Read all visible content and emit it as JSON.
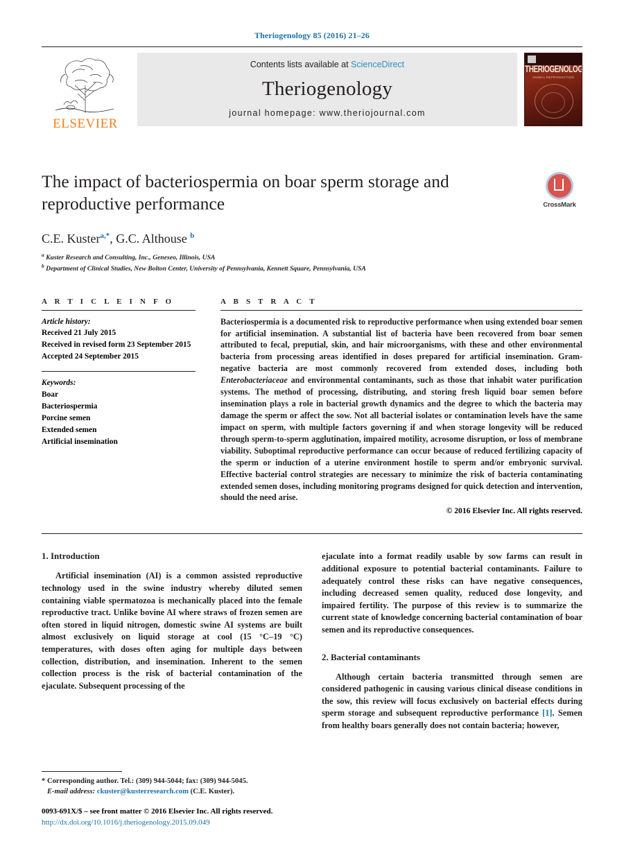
{
  "running_head": "Theriogenology 85 (2016) 21–26",
  "masthead": {
    "contents_prefix": "Contents lists available at ",
    "sciencedirect": "ScienceDirect",
    "journal_name": "Theriogenology",
    "homepage": "journal homepage: www.theriojournal.com",
    "publisher_logo_text": "ELSEVIER",
    "cover_title": "THERIOGENOLOGY",
    "cover_subtitle": "ANIMAL REPRODUCTION"
  },
  "article": {
    "title": "The impact of bacteriospermia on boar sperm storage and reproductive performance",
    "crossmark_label": "CrossMark",
    "authors": [
      {
        "name": "C.E. Kuster",
        "marks": "a,*"
      },
      {
        "name": "G.C. Althouse",
        "marks": "b"
      }
    ],
    "authors_plain": "C.E. Kuster",
    "author2_plain": "G.C. Althouse",
    "affiliations": [
      {
        "mark": "a",
        "text": "Kuster Research and Consulting, Inc., Geneseo, Illinois, USA"
      },
      {
        "mark": "b",
        "text": "Department of Clinical Studies, New Bolton Center, University of Pennsylvania, Kennett Square, Pennsylvania, USA"
      }
    ]
  },
  "article_info": {
    "heading": "A R T I C L E  I N F O",
    "history_label": "Article history:",
    "history": [
      "Received 21 July 2015",
      "Received in revised form 23 September 2015",
      "Accepted 24 September 2015"
    ],
    "keywords_label": "Keywords:",
    "keywords": [
      "Boar",
      "Bacteriospermia",
      "Porcine semen",
      "Extended semen",
      "Artificial insemination"
    ]
  },
  "abstract": {
    "heading": "A B S T R A C T",
    "part1": "Bacteriospermia is a documented risk to reproductive performance when using extended boar semen for artificial insemination. A substantial list of bacteria have been recovered from boar semen attributed to fecal, preputial, skin, and hair microorganisms, with these and other environmental bacteria from processing areas identified in doses prepared for artificial insemination. Gram-negative bacteria are most commonly recovered from extended doses, including both ",
    "italic1": "Enterobacteriaceae",
    "part2": " and environmental contaminants, such as those that inhabit water purification systems. The method of processing, distributing, and storing fresh liquid boar semen before insemination plays a role in bacterial growth dynamics and the degree to which the bacteria may damage the sperm or affect the sow. Not all bacterial isolates or contamination levels have the same impact on sperm, with multiple factors governing if and when storage longevity will be reduced through sperm-to-sperm agglutination, impaired motility, acrosome disruption, or loss of membrane viability. Suboptimal reproductive performance can occur because of reduced fertilizing capacity of the sperm or induction of a uterine environment hostile to sperm and/or embryonic survival. Effective bacterial control strategies are necessary to minimize the risk of bacteria contaminating extended semen doses, including monitoring programs designed for quick detection and intervention, should the need arise.",
    "copyright": "© 2016 Elsevier Inc. All rights reserved."
  },
  "body": {
    "section1_heading": "1. Introduction",
    "section1_para1": "Artificial insemination (AI) is a common assisted reproductive technology used in the swine industry whereby diluted semen containing viable spermatozoa is mechanically placed into the female reproductive tract. Unlike bovine AI where straws of frozen semen are often stored in liquid nitrogen, domestic swine AI systems are built almost exclusively on liquid storage at cool (15 °C–19 °C) temperatures, with doses often aging for multiple days between collection, distribution, and insemination. Inherent to the semen collection process is the risk of bacterial contamination of the ejaculate. Subsequent processing of the",
    "section1_para1_cont": "ejaculate into a format readily usable by sow farms can result in additional exposure to potential bacterial contaminants. Failure to adequately control these risks can have negative consequences, including decreased semen quality, reduced dose longevity, and impaired fertility. The purpose of this review is to summarize the current state of knowledge concerning bacterial contamination of boar semen and its reproductive consequences.",
    "section2_heading": "2. Bacterial contaminants",
    "section2_para1_a": "Although certain bacteria transmitted through semen are considered pathogenic in causing various clinical disease conditions in the sow, this review will focus exclusively on bacterial effects during sperm storage and subsequent reproductive performance ",
    "section2_ref": "[1]",
    "section2_para1_b": ". Semen from healthy boars generally does not contain bacteria; however,"
  },
  "footnotes": {
    "corresponding": "* Corresponding author. Tel.: (309) 944-5044; fax: (309) 944-5045.",
    "email_label": "E-mail address:",
    "email": "ckuster@kusterresearch.com",
    "email_owner": "(C.E. Kuster).",
    "issn": "0093-691X/$ – see front matter © 2016 Elsevier Inc. All rights reserved.",
    "doi": "http://dx.doi.org/10.1016/j.theriogenology.2015.09.049"
  },
  "colors": {
    "link_blue": "#1b72a8",
    "sciencedirect_blue": "#2f8fc4",
    "elsevier_orange": "#f08020",
    "masthead_gray": "#e9e9e9"
  }
}
